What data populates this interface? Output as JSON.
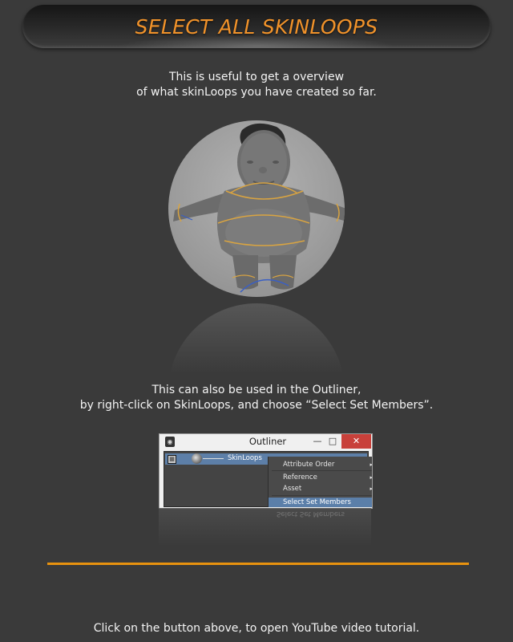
{
  "header": {
    "title": "SELECT ALL SKINLOOPS"
  },
  "intro": {
    "line1": "This is useful to get a overview",
    "line2": "of what skinLoops you have created so far."
  },
  "outliner_text": {
    "line1": "This can also be used in the Outliner,",
    "line2": "by right-click on SkinLoops, and choose “Select Set Members”."
  },
  "outliner_window": {
    "title": "Outliner",
    "minimize": "—",
    "maximize": "□",
    "close": "✕",
    "tree_item": "SkinLoops",
    "context_menu": [
      {
        "label": "Attribute Order",
        "submenu": true
      },
      {
        "label": "Reference",
        "submenu": true
      },
      {
        "label": "Asset",
        "submenu": true
      },
      {
        "label": "Select Set Members",
        "submenu": false,
        "selected": true
      }
    ],
    "reflected_label": "Select Set Members"
  },
  "footer": {
    "text": "Click on the button above, to open YouTube video tutorial."
  },
  "colors": {
    "accent_orange": "#f0922a",
    "background": "#3a3a3a",
    "selection_blue": "#5b7fa9"
  },
  "icons": [
    "maya-app-icon",
    "set-icon",
    "sphere-node-icon",
    "submenu-arrow-icon"
  ]
}
